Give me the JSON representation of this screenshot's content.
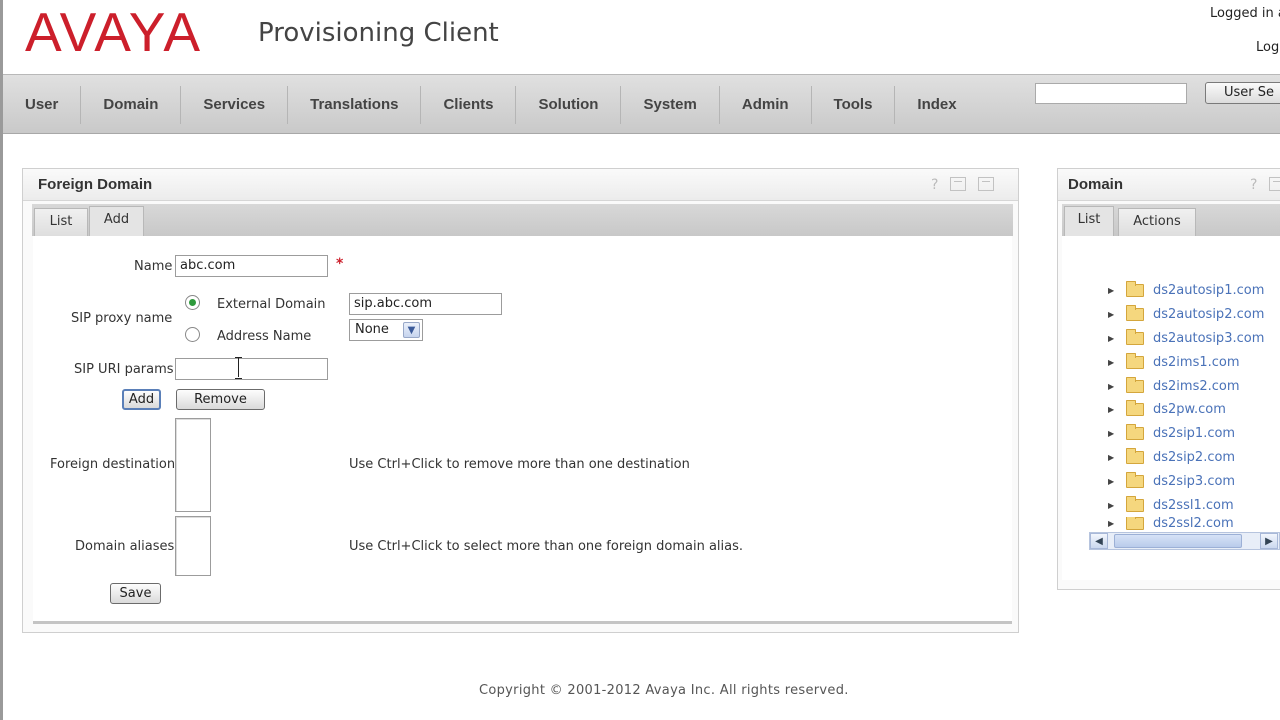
{
  "header": {
    "logo_text": "AVAYA",
    "app_title": "Provisioning Client",
    "logged_in": "Logged in a",
    "logout": "Log"
  },
  "nav": {
    "items": [
      "User",
      "Domain",
      "Services",
      "Translations",
      "Clients",
      "Solution",
      "System",
      "Admin",
      "Tools",
      "Index"
    ],
    "search_value": "",
    "search_button": "User Se"
  },
  "foreign_domain_panel": {
    "title": "Foreign Domain",
    "help_icon": "?",
    "tabs": [
      {
        "label": "List"
      },
      {
        "label": "Add"
      }
    ],
    "active_tab": "Add",
    "form": {
      "name_label": "Name",
      "name_value": "abc.com",
      "required_mark": "*",
      "sip_proxy_label": "SIP proxy name",
      "external_domain_label": "External Domain",
      "external_domain_value": "sip.abc.com",
      "address_name_label": "Address Name",
      "address_name_select": "None",
      "sip_uri_params_label": "SIP URI params",
      "sip_uri_params_value": "",
      "add_button": "Add",
      "remove_button": "Remove",
      "foreign_destination_label": "Foreign destination",
      "foreign_destination_hint": "Use Ctrl+Click to remove more than one destination",
      "domain_aliases_label": "Domain aliases",
      "domain_aliases_hint": "Use Ctrl+Click to select more than one foreign domain alias.",
      "save_button": "Save"
    }
  },
  "domain_panel": {
    "title": "Domain",
    "help_icon": "?",
    "tabs": [
      {
        "label": "List"
      },
      {
        "label": "Actions"
      }
    ],
    "active_tab": "List",
    "domains": [
      "ds2autosip1.com",
      "ds2autosip2.com",
      "ds2autosip3.com",
      "ds2ims1.com",
      "ds2ims2.com",
      "ds2pw.com",
      "ds2sip1.com",
      "ds2sip2.com",
      "ds2sip3.com",
      "ds2ssl1.com",
      "ds2ssl2.com"
    ]
  },
  "footer": {
    "copyright": "Copyright © 2001-2012 Avaya Inc. All rights reserved."
  },
  "colors": {
    "brand_red": "#cc1f2b",
    "link_blue": "#4a72b8",
    "radio_green": "#2e9a3c"
  }
}
